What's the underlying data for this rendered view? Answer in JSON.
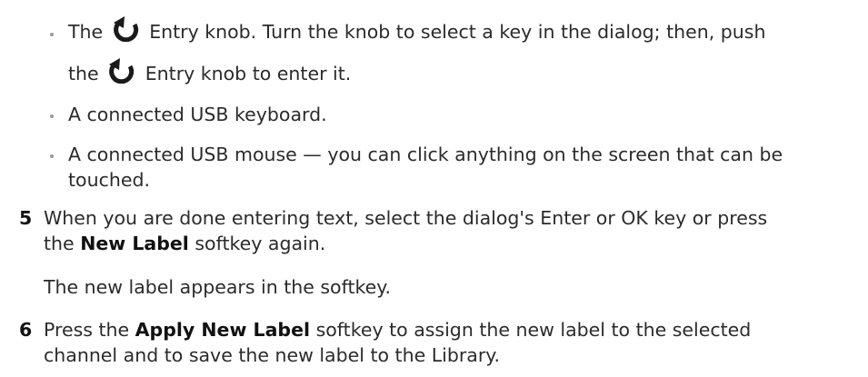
{
  "bullets": [
    {
      "line1_a": "The",
      "line1_b": "Entry knob. Turn the knob to select a key in the dialog; then, push",
      "line2_a": "the",
      "line2_b": "Entry knob to enter it."
    },
    {
      "line1": "A connected USB keyboard."
    },
    {
      "line1": "A connected USB mouse — you can click anything on the screen that can be",
      "line2": "touched."
    }
  ],
  "steps": [
    {
      "number": "5",
      "line1": "When you are done entering text, select the dialog's Enter or OK key or press",
      "line2_a": "the",
      "line2_bold": "New Label",
      "line2_b": "softkey again.",
      "result": "The new label appears in the softkey."
    },
    {
      "number": "6",
      "line1_a": "Press the",
      "line1_bold": "Apply New Label",
      "line1_b": "softkey to assign the new label to the selected",
      "line2": "channel and to save the new label to the Library."
    }
  ],
  "icons": {
    "knob": "entry-knob-rotate-icon"
  }
}
